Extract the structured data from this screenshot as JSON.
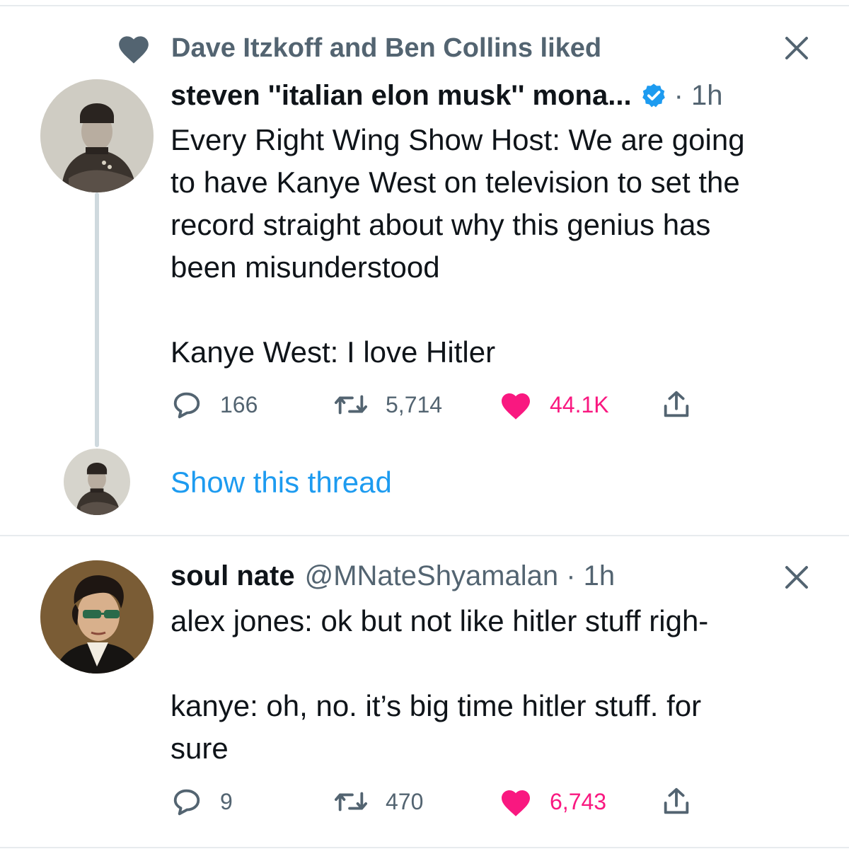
{
  "social_context": {
    "text": "Dave Itzkoff and Ben Collins liked",
    "icon": "heart-icon"
  },
  "tweet1": {
    "name": "steven ''italian elon musk'' mona...",
    "verified": true,
    "meta": "· 1h",
    "body": "Every Right Wing Show Host: We are going\nto have Kanye West on television to set the\nrecord straight about why this genius has\nbeen misunderstood\n\nKanye West: I love Hitler",
    "replies": "166",
    "retweets": "5,714",
    "likes": "44.1K",
    "liked": true,
    "show_thread": "Show this thread"
  },
  "tweet2": {
    "name": "soul nate",
    "handle": "@MNateShyamalan · 1h",
    "body": "alex jones: ok but not like hitler stuff righ-\n\nkanye: oh, no. it’s big time hitler stuff. for\nsure",
    "replies": "9",
    "retweets": "470",
    "likes": "6,743",
    "liked": true
  },
  "colors": {
    "text": "#0f1419",
    "secondary": "#536471",
    "link": "#1d9bf0",
    "like": "#f91880",
    "verified": "#1d9bf0",
    "divider": "#e7ebee"
  },
  "icons": [
    "heart-icon",
    "close-icon",
    "verified-badge-icon",
    "reply-icon",
    "retweet-icon",
    "like-icon",
    "share-icon"
  ]
}
